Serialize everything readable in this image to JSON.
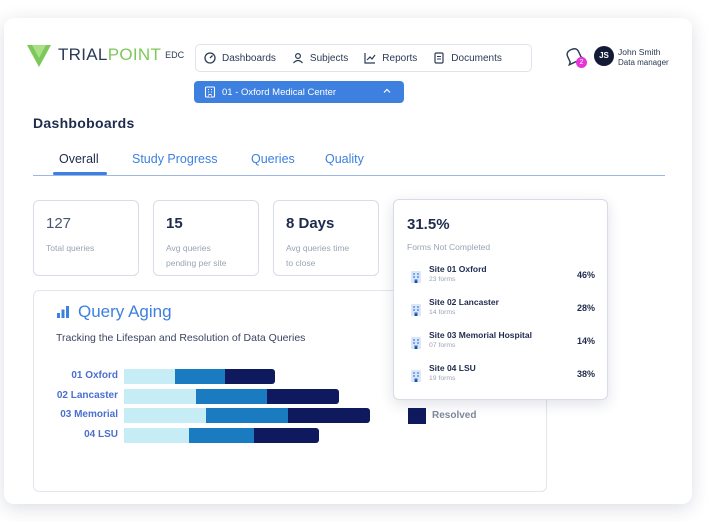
{
  "brand": {
    "name_a": "TRIAL",
    "name_b": "POINT",
    "suffix": "EDC",
    "accent": "#7dc85a"
  },
  "nav": [
    {
      "label": "Dashboards",
      "icon": "gauge-icon"
    },
    {
      "label": "Subjects",
      "icon": "person-icon"
    },
    {
      "label": "Reports",
      "icon": "chart-line-icon"
    },
    {
      "label": "Documents",
      "icon": "document-icon"
    }
  ],
  "notifications": {
    "count": "2"
  },
  "user": {
    "initials": "JS",
    "name": "John Smith",
    "role": "Data manager"
  },
  "site_selector": {
    "value": "01 - Oxford Medical Center"
  },
  "page_title": "Dashboboards",
  "tabs": [
    {
      "label": "Overall",
      "active": true
    },
    {
      "label": "Study Progress",
      "active": false
    },
    {
      "label": "Queries",
      "active": false
    },
    {
      "label": "Quality",
      "active": false
    }
  ],
  "stats": [
    {
      "value": "127",
      "label_1": "Total queries",
      "label_2": ""
    },
    {
      "value": "15",
      "label_1": "Avg queries",
      "label_2": "pending per site"
    },
    {
      "value": "8 Days",
      "label_1": "Avg queries time",
      "label_2": "to close"
    }
  ],
  "query_aging": {
    "title": "Query Aging",
    "subtitle": "Tracking the Lifespan and Resolution of Data Queries",
    "colors": [
      "#c6ecf5",
      "#1a7bc0",
      "#0f1a5e"
    ],
    "rows": [
      {
        "label": "01 Oxford"
      },
      {
        "label": "02 Lancaster"
      },
      {
        "label": "03 Memorial"
      },
      {
        "label": "04 LSU"
      }
    ],
    "legend": [
      {
        "label": "Resolved",
        "color": "#0f1a5e"
      }
    ]
  },
  "forms_popover": {
    "value": "31.5%",
    "label": "Forms Not Completed",
    "sites": [
      {
        "name": "Site 01 Oxford",
        "forms": "23 forms",
        "pct": "46%"
      },
      {
        "name": "Site 02 Lancaster",
        "forms": "14 forms",
        "pct": "28%"
      },
      {
        "name": "Site 03 Memorial Hospital",
        "forms": "07 forms",
        "pct": "14%"
      },
      {
        "name": "Site 04 LSU",
        "forms": "19 forms",
        "pct": "38%"
      }
    ]
  }
}
